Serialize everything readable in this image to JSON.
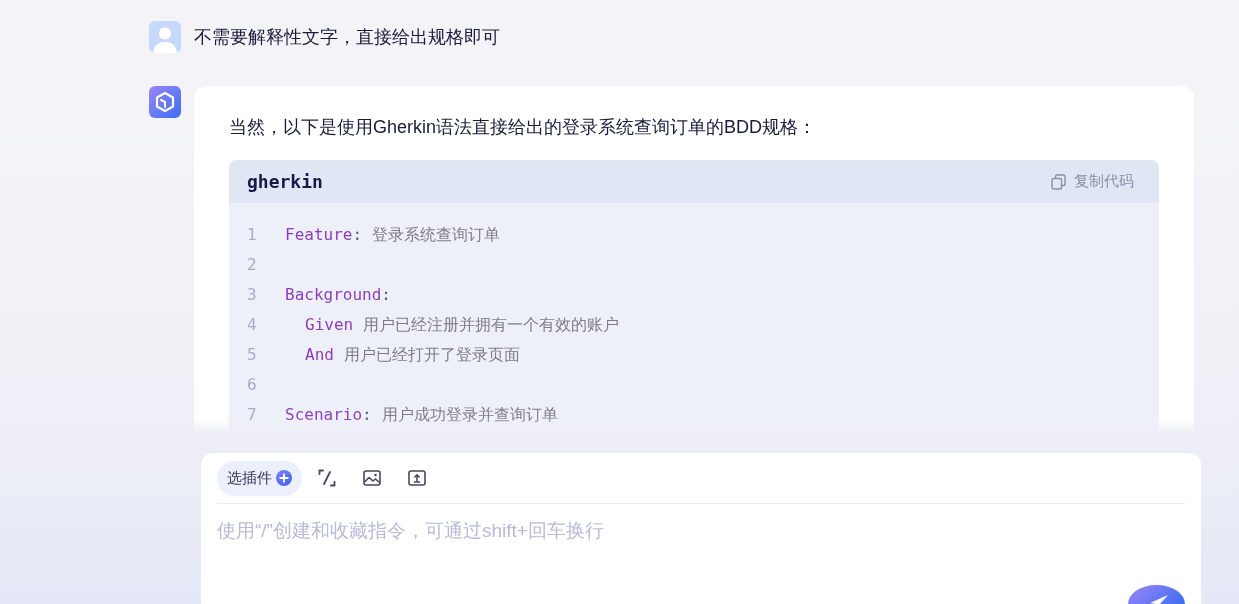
{
  "messages": [
    {
      "kind": "user",
      "text": "不需要解释性文字，直接给出规格即可"
    },
    {
      "kind": "assistant",
      "intro": "当然，以下是使用Gherkin语法直接给出的登录系统查询订单的BDD规格：",
      "code_block": {
        "language": "gherkin",
        "copy_label": "复制代码",
        "lines": [
          {
            "number": "1",
            "keyword": "Feature",
            "separator": ":",
            "text": "登录系统查询订单"
          },
          {
            "number": "2"
          },
          {
            "number": "3",
            "keyword": "Background",
            "separator": ":",
            "children": [
              {
                "number": "4",
                "keyword": "Given",
                "text": "用户已经注册并拥有一个有效的账户"
              },
              {
                "number": "5",
                "keyword": "And",
                "text": "用户已经打开了登录页面"
              }
            ]
          },
          {
            "number": "6"
          },
          {
            "number": "7",
            "keyword": "Scenario",
            "separator": ":",
            "text": "用户成功登录并查询订单"
          }
        ]
      }
    }
  ],
  "composer": {
    "plugin_button": "选插件",
    "placeholder": "使用“/”创建和收藏指令，可通过shift+回车换行"
  }
}
